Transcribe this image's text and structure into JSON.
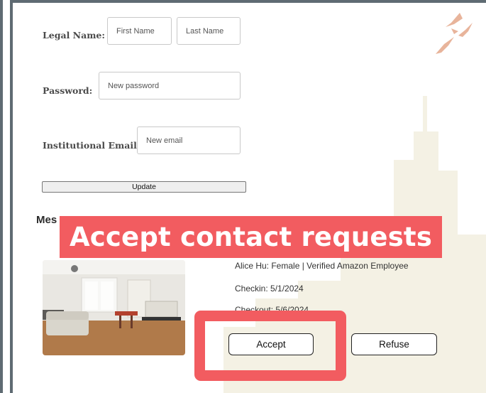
{
  "form": {
    "legal_name_label": "Legal Name:",
    "first_name_placeholder": "First Name",
    "last_name_placeholder": "Last Name",
    "password_label": "Password:",
    "password_placeholder": "New password",
    "email_label": "Institutional Email:",
    "email_placeholder": "New email",
    "update_label": "Update"
  },
  "messages": {
    "section_title_partial": "Mes",
    "request": {
      "guest_line": "Alice Hu: Female | Verified Amazon Employee",
      "checkin": "Checkin: 5/1/2024",
      "checkout": "Checkout: 5/6/2024",
      "accept_label": "Accept",
      "refuse_label": "Refuse"
    }
  },
  "overlay": {
    "banner_text": "Accept contact requests",
    "accent_color": "#f25c60"
  },
  "colors": {
    "skyline": "#f4f1e4",
    "birds": "#e8b49b",
    "frame": "#5f6b73"
  }
}
